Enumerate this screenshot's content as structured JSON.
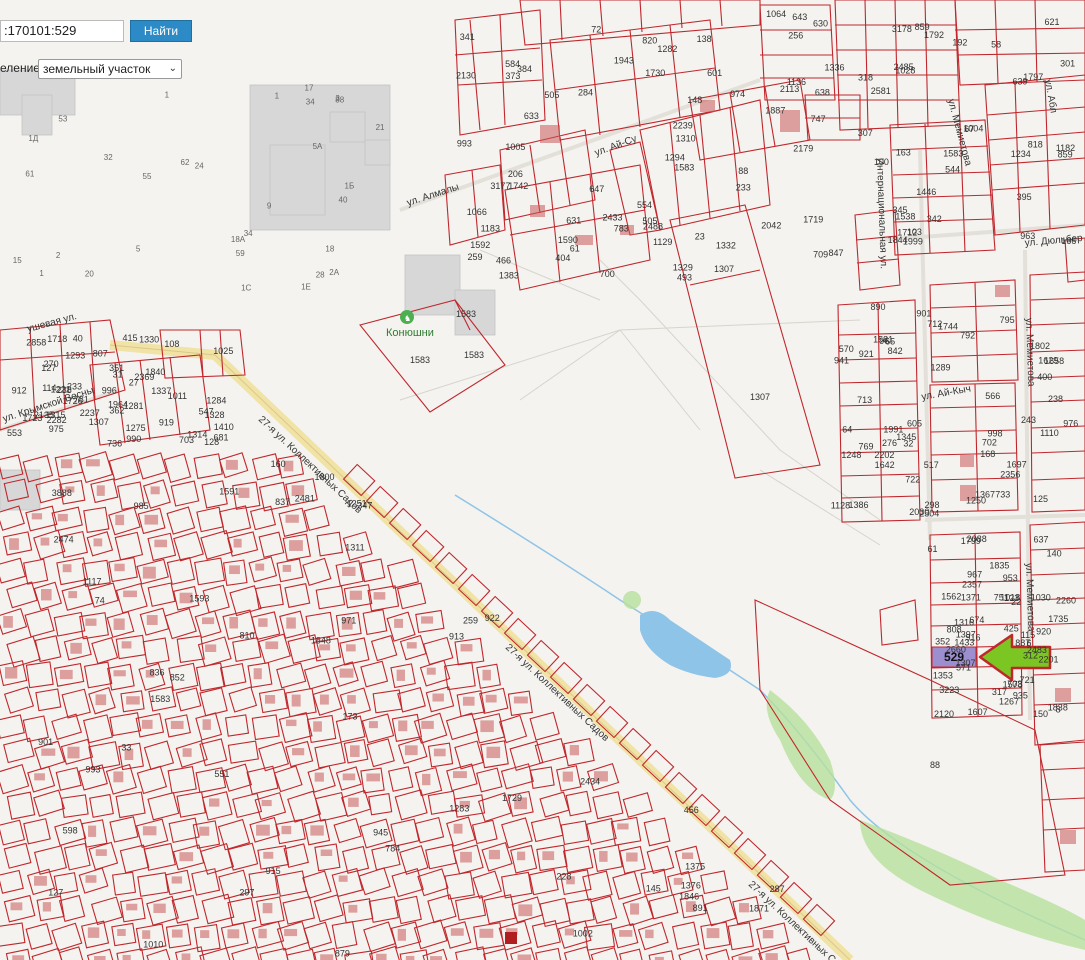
{
  "search": {
    "value": ":170101:529",
    "button_label": "Найти"
  },
  "layer": {
    "label": "еление:",
    "selected": "земельный участок"
  },
  "streets": [
    "ул. Алмалы",
    "ул. Ай-Су",
    "27-я ул. Коллективных Садов",
    "27-я ул. Коллективных Садов",
    "27-я ул. Коллективных Садов",
    "ул. Крымской Весны",
    "ул. Дюльбер",
    "Интернациональная ул.",
    "ул. Мемиетова",
    "ул. Мемиетова",
    "ул. Мемиетова",
    "ул. Ай-Кыч",
    "ушевая ул.",
    "ул. Абл"
  ],
  "poi": {
    "name": "Конюшни",
    "icon": "horse-icon",
    "color": "#4caf50"
  },
  "highlight": {
    "label": "529",
    "fill": "#9b8fcf",
    "arrow_color": "#7bc623",
    "arrow_stroke": "#c0272d"
  },
  "colors": {
    "parcel": "#c0272d",
    "water": "#8ec4e8",
    "green": "#a8d98c",
    "road": "#f1e3a6"
  },
  "parcel_labels": [
    "1183",
    "1182",
    "168",
    "1578",
    "238",
    "145",
    "61",
    "342",
    "921",
    "150",
    "781",
    "173",
    "284",
    "103",
    "890",
    "352",
    "31",
    "33",
    "259",
    "166",
    "976",
    "317",
    "108",
    "287",
    "3177",
    "3178",
    "722",
    "674",
    "351",
    "784",
    "631",
    "630",
    "795",
    "721",
    "547",
    "879",
    "700",
    "818",
    "125",
    "1397",
    "990",
    "1311",
    "466",
    "1336",
    "712",
    "22",
    "1315",
    "1010",
    "974",
    "395",
    "570",
    "1267",
    "362",
    "837",
    "554",
    "345",
    "298",
    "935",
    "912",
    "1376",
    "820",
    "709",
    "1250",
    "703",
    "1275",
    "852",
    "584",
    "1064",
    "1248",
    "1030",
    "1410",
    "347",
    "505",
    "544",
    "733",
    "1307",
    "1307",
    "1583",
    "1583",
    "1583",
    "96",
    "887",
    "2369",
    "74",
    "373",
    "67",
    "65",
    "312",
    "270",
    "913",
    "72",
    "163",
    "64",
    "140",
    "2282",
    "1283",
    "1129",
    "859",
    "901",
    "916",
    "919",
    "891",
    "233",
    "1136",
    "32",
    "1562",
    "553",
    "993",
    "341",
    "963",
    "792",
    "61",
    "1328",
    "945",
    "647",
    "58",
    "566",
    "8",
    "127",
    "922",
    "1282",
    "639",
    "605",
    "571",
    "681",
    "456",
    "633",
    "643",
    "400",
    "3223",
    "1314",
    "1002",
    "23",
    "638",
    "1367",
    "920",
    "1281",
    "810",
    "384",
    "256",
    "998",
    "953",
    "40",
    "551",
    "601",
    "859",
    "517",
    "1018",
    "807",
    "971",
    "138",
    "621",
    "702",
    "2660",
    "1284",
    "1251",
    "1310",
    "192",
    "1386",
    "1353",
    "736",
    "160",
    "1294",
    "2581",
    "238",
    "637",
    "1337",
    "836",
    "1332",
    "747",
    "1289",
    "751",
    "1221",
    "1375",
    "1383",
    "847",
    "1345",
    "967",
    "996",
    "985",
    "88",
    "301",
    "243",
    "123",
    "114",
    "259",
    "404",
    "100",
    "1697",
    "115",
    "128",
    "127",
    "1329",
    "307",
    "276",
    "1371",
    "233",
    "2434",
    "2433",
    "1719",
    "1802",
    "1735",
    "1718",
    "228",
    "148",
    "1028",
    "842",
    "1607",
    "27",
    "1871",
    "993",
    "1004",
    "941",
    "1799",
    "1723",
    "1800",
    "206",
    "1797",
    "2356",
    "2357",
    "1726",
    "1729",
    "1730",
    "1712",
    "2504",
    "2483",
    "1011",
    "2481",
    "493",
    "1538",
    "1629",
    "808",
    "1025",
    "297",
    "1742",
    "1446",
    "1658",
    "1433",
    "415",
    "598",
    "783",
    "318",
    "769",
    "425",
    "975",
    "1848",
    "1943",
    "1792",
    "1581",
    "1838",
    "1840",
    "1846",
    "2239",
    "1234",
    "1744",
    "1316",
    "2858",
    "3888",
    "1590",
    "2113",
    "1128",
    "2088",
    "2135",
    "1591",
    "2130",
    "2179",
    "2202",
    "2201",
    "1293",
    "1117",
    "1592",
    "2042",
    "2030",
    "2120",
    "1330",
    "1593",
    "1005",
    "1844",
    "713",
    "6",
    "703",
    "915",
    "1066",
    "1887",
    "1642",
    "1835",
    "1964",
    "901",
    "505",
    "1999",
    "1991",
    "2260",
    "2237",
    "2474",
    "2488",
    "2485",
    "1110"
  ],
  "numbers": [
    "2А",
    "1",
    "1Д",
    "1Е",
    "1С",
    "1Б",
    "5А",
    "5",
    "9",
    "32",
    "34",
    "28",
    "24",
    "17",
    "18А",
    "18",
    "53",
    "55",
    "59",
    "61",
    "62",
    "2",
    "3",
    "20",
    "34",
    "40",
    "21",
    "88",
    "1",
    "15",
    "1"
  ]
}
